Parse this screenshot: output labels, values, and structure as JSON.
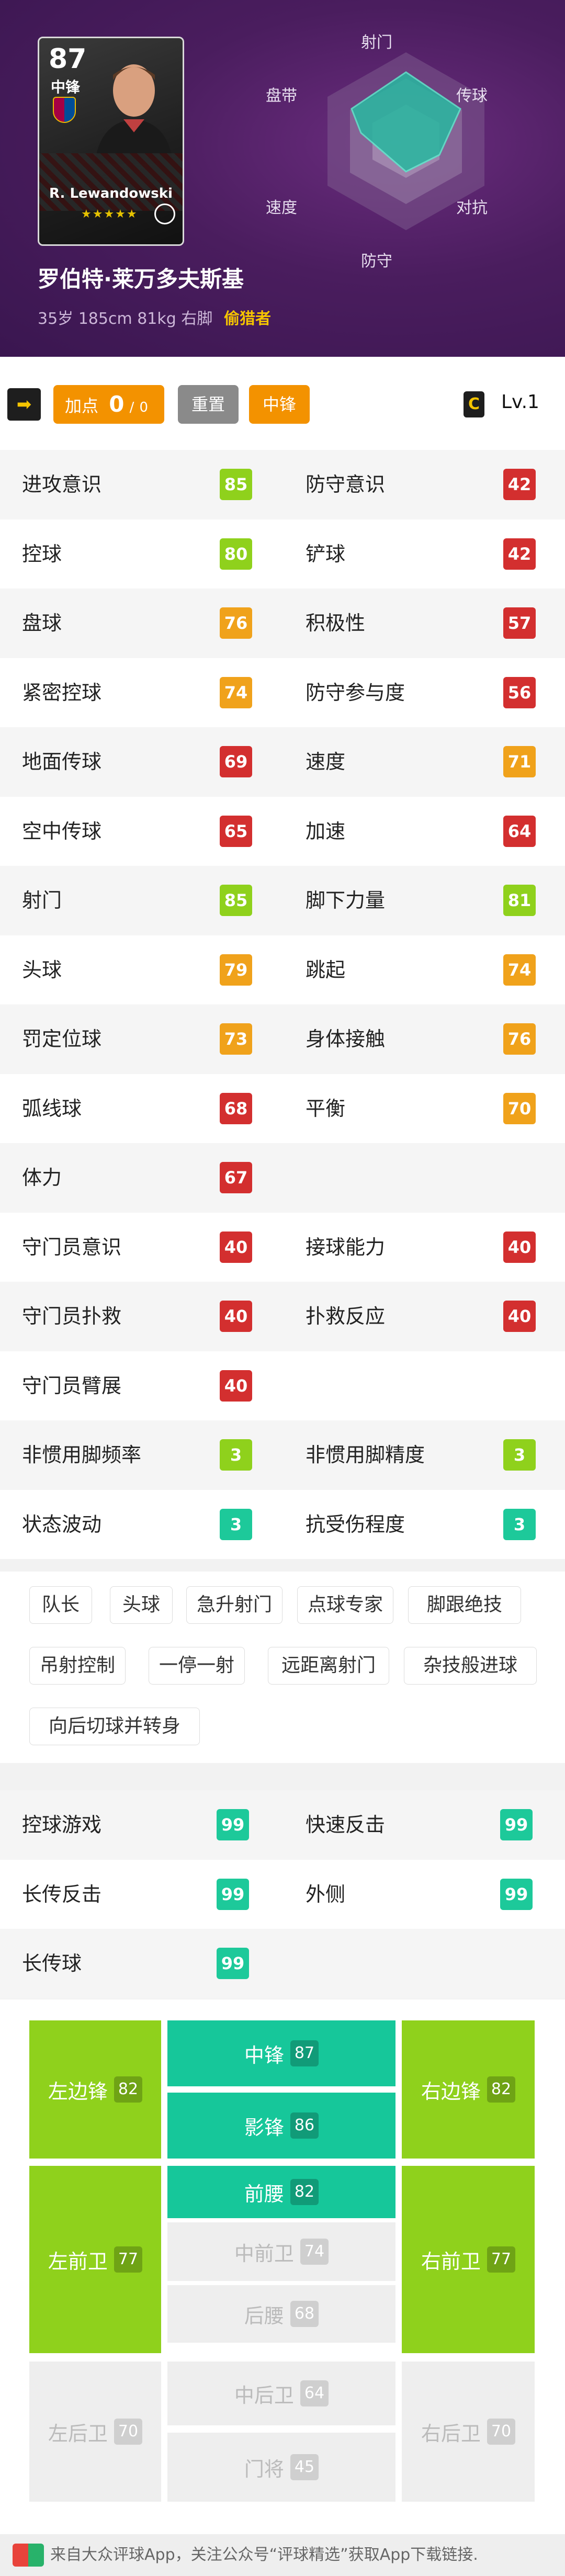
{
  "card": {
    "rating": "87",
    "position": "中锋",
    "name": "R. Lewandowski",
    "stars": "★★★★★"
  },
  "player": {
    "name": "罗伯特·莱万多夫斯基",
    "info": "35岁 185cm 81kg 右脚",
    "tag": "偷猎者"
  },
  "radar_labels": [
    "射门",
    "传球",
    "对抗",
    "防守",
    "速度",
    "盘带"
  ],
  "toolbar": {
    "add_label": "加点",
    "add_value": "0",
    "add_sep": "/",
    "add_total": "0",
    "reset_label": "重置",
    "position_label": "中锋",
    "arrow_icon": "➡",
    "level_icon": "C",
    "level_label": "Lv.1"
  },
  "colors": {
    "green": "#8fd11c",
    "orange": "#f0a21b",
    "red": "#d32f2f",
    "teal": "#1dc99a",
    "grey": "#b0b0b0",
    "pos_green": "#8fd11c",
    "pos_teal": "#16c79a",
    "pos_grey": "#eeeeee"
  },
  "stats": [
    [
      {
        "label": "进攻意识",
        "value": "85",
        "color": "green"
      },
      {
        "label": "防守意识",
        "value": "42",
        "color": "red"
      }
    ],
    [
      {
        "label": "控球",
        "value": "80",
        "color": "green"
      },
      {
        "label": "铲球",
        "value": "42",
        "color": "red"
      }
    ],
    [
      {
        "label": "盘球",
        "value": "76",
        "color": "orange"
      },
      {
        "label": "积极性",
        "value": "57",
        "color": "red"
      }
    ],
    [
      {
        "label": "紧密控球",
        "value": "74",
        "color": "orange"
      },
      {
        "label": "防守参与度",
        "value": "56",
        "color": "red"
      }
    ],
    [
      {
        "label": "地面传球",
        "value": "69",
        "color": "red"
      },
      {
        "label": "速度",
        "value": "71",
        "color": "orange"
      }
    ],
    [
      {
        "label": "空中传球",
        "value": "65",
        "color": "red"
      },
      {
        "label": "加速",
        "value": "64",
        "color": "red"
      }
    ],
    [
      {
        "label": "射门",
        "value": "85",
        "color": "green"
      },
      {
        "label": "脚下力量",
        "value": "81",
        "color": "green"
      }
    ],
    [
      {
        "label": "头球",
        "value": "79",
        "color": "orange"
      },
      {
        "label": "跳起",
        "value": "74",
        "color": "orange"
      }
    ],
    [
      {
        "label": "罚定位球",
        "value": "73",
        "color": "orange"
      },
      {
        "label": "身体接触",
        "value": "76",
        "color": "orange"
      }
    ],
    [
      {
        "label": "弧线球",
        "value": "68",
        "color": "red"
      },
      {
        "label": "平衡",
        "value": "70",
        "color": "orange"
      }
    ],
    [
      {
        "label": "体力",
        "value": "67",
        "color": "red"
      },
      null
    ],
    [
      {
        "label": "守门员意识",
        "value": "40",
        "color": "red"
      },
      {
        "label": "接球能力",
        "value": "40",
        "color": "red"
      }
    ],
    [
      {
        "label": "守门员扑救",
        "value": "40",
        "color": "red"
      },
      {
        "label": "扑救反应",
        "value": "40",
        "color": "red"
      }
    ],
    [
      {
        "label": "守门员臂展",
        "value": "40",
        "color": "red"
      },
      null
    ],
    [
      {
        "label": "非惯用脚频率",
        "value": "3",
        "color": "green"
      },
      {
        "label": "非惯用脚精度",
        "value": "3",
        "color": "green"
      }
    ],
    [
      {
        "label": "状态波动",
        "value": "3",
        "color": "teal"
      },
      {
        "label": "抗受伤程度",
        "value": "3",
        "color": "teal"
      }
    ]
  ],
  "skills": [
    "队长",
    "头球",
    "急升射门",
    "点球专家",
    "脚跟绝技",
    "吊射控制",
    "一停一射",
    "远距离射门",
    "杂技般进球",
    "向后切球并转身"
  ],
  "special": [
    [
      {
        "label": "控球游戏",
        "value": "99"
      },
      {
        "label": "快速反击",
        "value": "99"
      }
    ],
    [
      {
        "label": "长传反击",
        "value": "99"
      },
      {
        "label": "外侧",
        "value": "99"
      }
    ],
    [
      {
        "label": "长传球",
        "value": "99"
      },
      null
    ]
  ],
  "positions": [
    {
      "label": "左边锋",
      "value": "82",
      "color": "pos_green"
    },
    {
      "label": "中锋",
      "value": "87",
      "color": "pos_teal"
    },
    {
      "label": "右边锋",
      "value": "82",
      "color": "pos_green"
    },
    {
      "label": "影锋",
      "value": "86",
      "color": "pos_teal"
    },
    {
      "label": "左前卫",
      "value": "77",
      "color": "pos_green"
    },
    {
      "label": "前腰",
      "value": "82",
      "color": "pos_teal"
    },
    {
      "label": "右前卫",
      "value": "77",
      "color": "pos_green"
    },
    {
      "label": "中前卫",
      "value": "74",
      "color": "pos_grey"
    },
    {
      "label": "后腰",
      "value": "68",
      "color": "pos_grey"
    },
    {
      "label": "左后卫",
      "value": "70",
      "color": "pos_grey"
    },
    {
      "label": "中后卫",
      "value": "64",
      "color": "pos_grey"
    },
    {
      "label": "右后卫",
      "value": "70",
      "color": "pos_grey"
    },
    {
      "label": "门将",
      "value": "45",
      "color": "pos_grey"
    }
  ],
  "footer": {
    "text": "来自大众评球App，关注公众号“评球精选”获取App下载链接."
  }
}
